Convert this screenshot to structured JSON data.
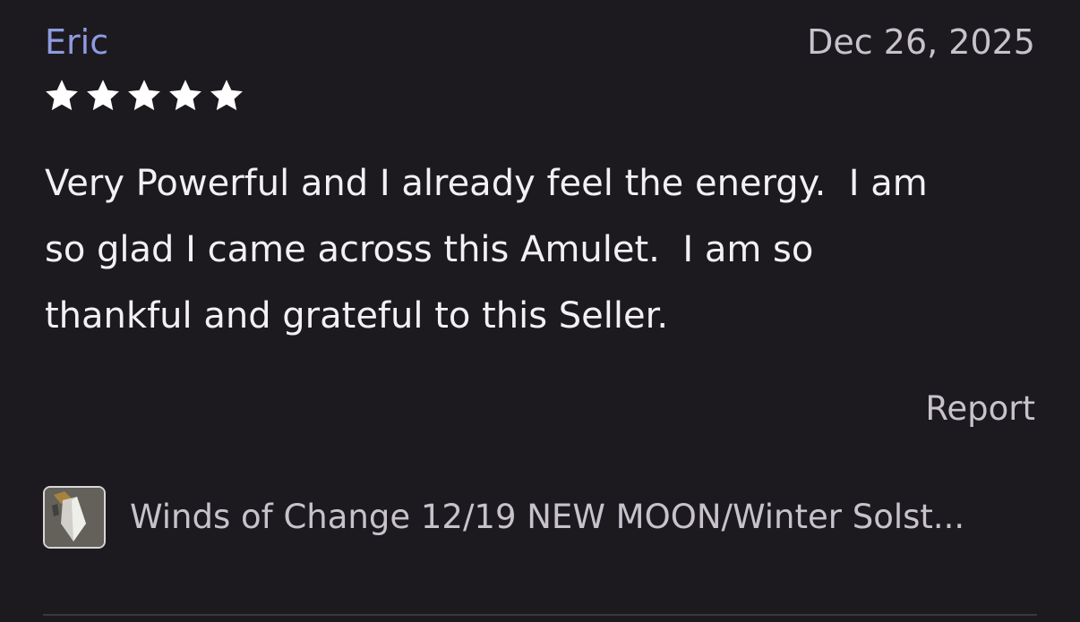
{
  "review": {
    "reviewer": "Eric",
    "date": "Dec 26, 2025",
    "rating": 5,
    "rating_max": 5,
    "text": "Very Powerful and I already feel the energy.  I am\nso glad I came across this Amulet.  I am so\nthankful and grateful to this Seller.",
    "report_label": "Report"
  },
  "item": {
    "title": "Winds of Change 12/19 NEW MOON/Winter Solst...",
    "thumbnail_icon": "crystal-pendant-thumbnail"
  },
  "colors": {
    "background": "#1c1a1f",
    "reviewer_name": "#8f9be0",
    "muted_text": "#c7c2cb",
    "body_text": "#f2f0f4",
    "star": "#ffffff"
  }
}
